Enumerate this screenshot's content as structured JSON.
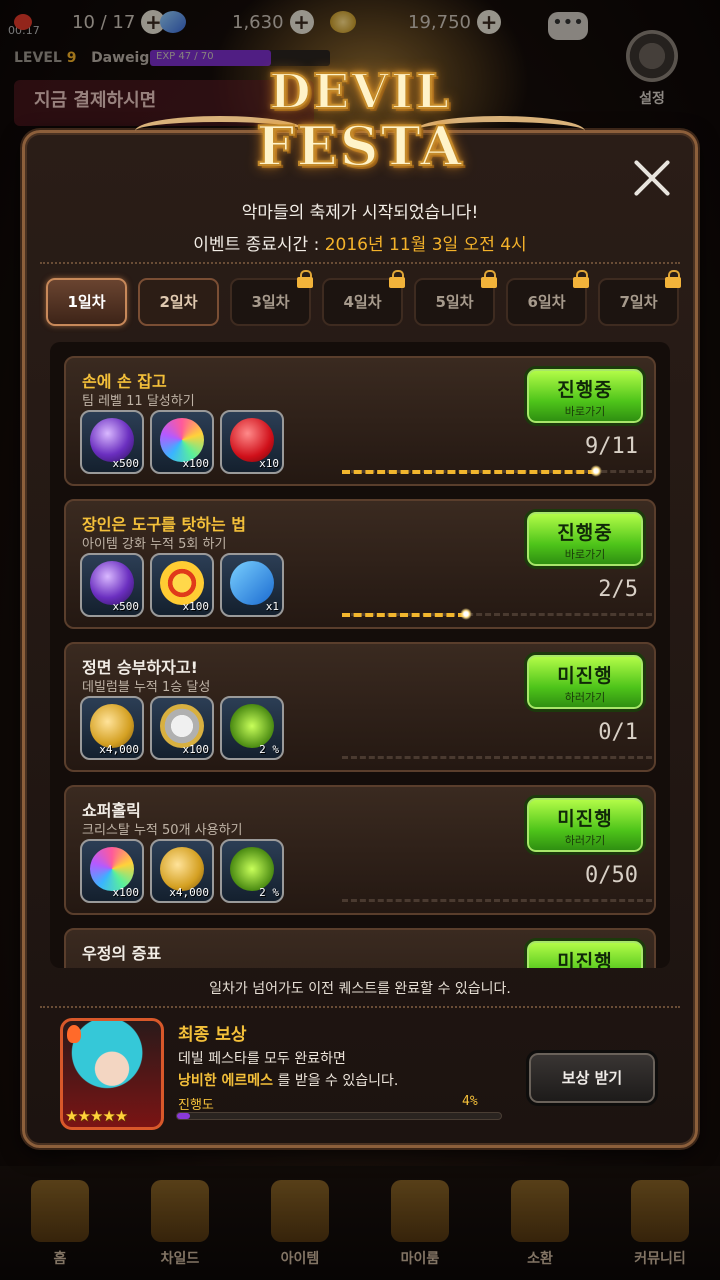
{
  "status_bar": {
    "clock": "00:17"
  },
  "resources": [
    {
      "name": "stamina",
      "value": "10 / 17",
      "icon": "heart-icon",
      "color": "#e03a2a"
    },
    {
      "name": "crystal",
      "value": "1,630",
      "icon": "crystal-icon",
      "color": "#6ab4ff"
    },
    {
      "name": "gold",
      "value": "19,750",
      "icon": "gold-icon",
      "color": "#e0b040"
    }
  ],
  "player": {
    "level_label": "LEVEL",
    "level": "9",
    "name": "Daweige",
    "exp": "EXP 47 / 70",
    "exp_fraction": 0.67
  },
  "settings_label": "설정",
  "background_banner": "지금 결제하시면",
  "logo": {
    "line1": "DEVIL",
    "line2": "FESTA"
  },
  "header": {
    "headline": "악마들의 축제가 시작되었습니다!",
    "end_label": "이벤트 종료시간 : ",
    "end_value": "2016년 11월 3일 오전 4시"
  },
  "tabs": [
    {
      "label": "1일차",
      "state": "active"
    },
    {
      "label": "2일차",
      "state": "open"
    },
    {
      "label": "3일차",
      "state": "locked"
    },
    {
      "label": "4일차",
      "state": "locked"
    },
    {
      "label": "5일차",
      "state": "locked"
    },
    {
      "label": "6일차",
      "state": "locked"
    },
    {
      "label": "7일차",
      "state": "locked"
    }
  ],
  "quests": [
    {
      "title": "손에 손 잡고",
      "title_color": "gold",
      "desc": "팀 레벨 11 달성하기",
      "rewards": [
        {
          "icon": "purple-gem-icon",
          "qty": "x500"
        },
        {
          "icon": "crystal-icon",
          "qty": "x100"
        },
        {
          "icon": "heart-icon",
          "qty": "x10"
        }
      ],
      "button_main": "진행중",
      "button_sub": "바로가기",
      "count": "9/11",
      "progress": 0.818
    },
    {
      "title": "장인은 도구를 탓하는 법",
      "title_color": "gold",
      "desc": "아이템 강화 누적 5회 하기",
      "rewards": [
        {
          "icon": "purple-gem-icon",
          "qty": "x500"
        },
        {
          "icon": "medal-icon",
          "qty": "x100"
        },
        {
          "icon": "ticket-icon",
          "qty": "x1"
        }
      ],
      "button_main": "진행중",
      "button_sub": "바로가기",
      "count": "2/5",
      "progress": 0.4
    },
    {
      "title": "정면 승부하자고!",
      "title_color": "white",
      "desc": "데빌럼블 누적 1승 달성",
      "rewards": [
        {
          "icon": "gold-pile-icon",
          "qty": "x4,000"
        },
        {
          "icon": "silver-coin-icon",
          "qty": "x100"
        },
        {
          "icon": "user-exp-icon",
          "qty": "2 %"
        }
      ],
      "button_main": "미진행",
      "button_sub": "하러가기",
      "count": "0/1",
      "progress": 0
    },
    {
      "title": "쇼퍼홀릭",
      "title_color": "white",
      "desc": "크리스탈 누적 50개 사용하기",
      "rewards": [
        {
          "icon": "crystal-icon",
          "qty": "x100"
        },
        {
          "icon": "gold-pile-icon",
          "qty": "x4,000"
        },
        {
          "icon": "user-exp-icon",
          "qty": "2 %"
        }
      ],
      "button_main": "미진행",
      "button_sub": "하러가기",
      "count": "0/50",
      "progress": 0
    },
    {
      "title": "우정의 증표",
      "title_color": "white",
      "desc": "",
      "rewards": [],
      "button_main": "미진행",
      "button_sub": "",
      "count": "",
      "progress": 0
    }
  ],
  "note": "일차가 넘어가도 이전 퀘스트를 완료할 수 있습니다.",
  "final_reward": {
    "title": "최종 보상",
    "line1": "데빌 페스타를 모두 완료하면",
    "line2_highlight": "낭비한 에르메스",
    "line2_rest": " 를 받을 수 있습니다.",
    "progress_label": "진행도",
    "progress_pct": "4%",
    "progress": 0.04,
    "stars": "★★★★★",
    "claim_label": "보상 받기"
  },
  "bottom_nav": [
    {
      "label": "홈",
      "icon": "home-icon"
    },
    {
      "label": "차일드",
      "icon": "child-icon"
    },
    {
      "label": "아이템",
      "icon": "item-icon"
    },
    {
      "label": "마이룸",
      "icon": "myroom-icon"
    },
    {
      "label": "소환",
      "icon": "summon-icon"
    },
    {
      "label": "커뮤니티",
      "icon": "community-icon"
    }
  ]
}
